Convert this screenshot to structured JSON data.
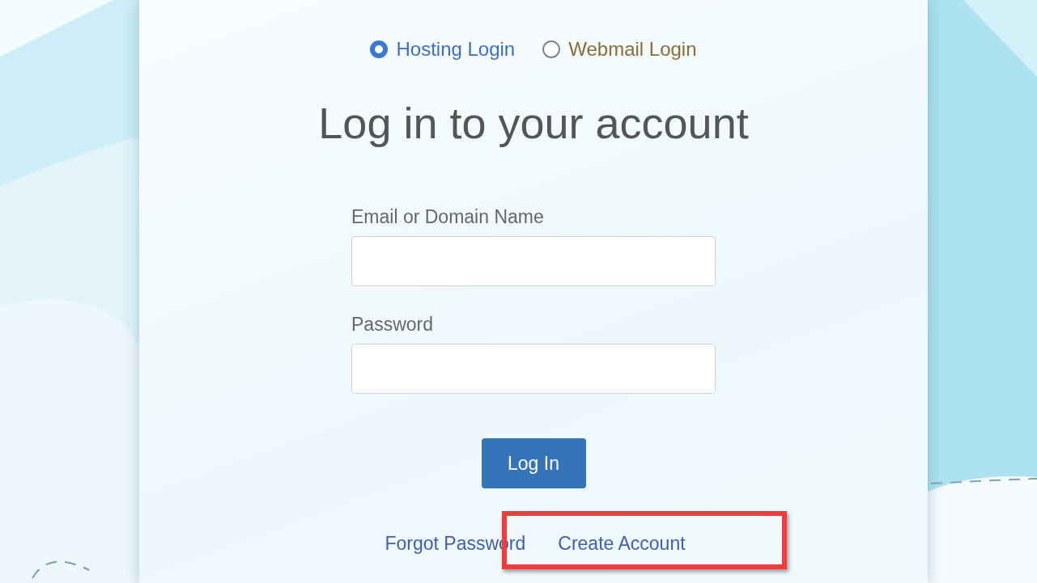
{
  "login_type": [
    {
      "label": "Hosting Login",
      "selected": true
    },
    {
      "label": "Webmail Login",
      "selected": false
    }
  ],
  "heading": "Log in to your account",
  "fields": [
    {
      "label": "Email or Domain Name"
    },
    {
      "label": "Password"
    }
  ],
  "submit": "Log In",
  "links": [
    {
      "label": "Forgot Password"
    },
    {
      "label": "Create Account"
    }
  ]
}
